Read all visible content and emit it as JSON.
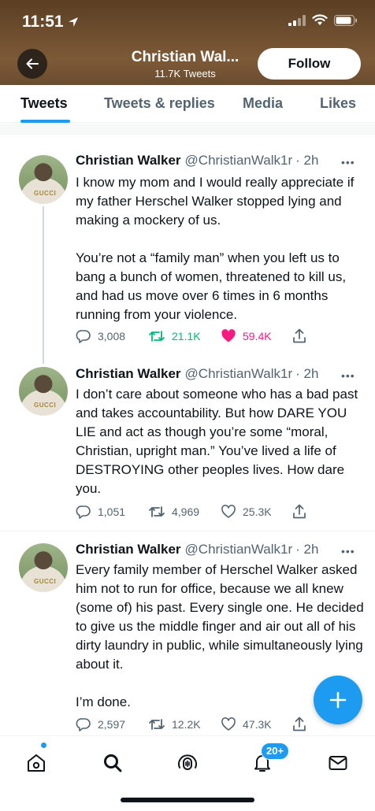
{
  "status_bar": {
    "time": "11:51",
    "icons": [
      "location-arrow-icon",
      "signal-icon",
      "wifi-icon",
      "battery-icon"
    ]
  },
  "header": {
    "name": "Christian Wal...",
    "tweet_count": "11.7K Tweets",
    "follow_label": "Follow"
  },
  "tabs": [
    {
      "label": "Tweets",
      "active": true
    },
    {
      "label": "Tweets & replies",
      "active": false
    },
    {
      "label": "Media",
      "active": false
    },
    {
      "label": "Likes",
      "active": false
    }
  ],
  "tweets": [
    {
      "name": "Christian Walker",
      "handle": "@ChristianWalk1r",
      "time": "· 2h",
      "avatar_text": "GUCCI",
      "paragraphs": [
        "I know my mom and I would really appreciate if my father Herschel Walker stopped lying and making a mockery of us.",
        "You’re not a “family man” when you left us to bang a bunch of women, threatened to kill us, and had us move over 6 times in 6 months running from your violence."
      ],
      "replies": "3,008",
      "retweets": "21.1K",
      "likes": "59.4K",
      "liked": true,
      "retweeted": true
    },
    {
      "name": "Christian Walker",
      "handle": "@ChristianWalk1r",
      "time": "· 2h",
      "avatar_text": "GUCCI",
      "paragraphs": [
        "I don’t care about someone who has a bad past and takes accountability. But how DARE YOU LIE and act as though you’re some “moral, Christian, upright man.” You’ve lived a life of DESTROYING other peoples lives.  How dare you."
      ],
      "replies": "1,051",
      "retweets": "4,969",
      "likes": "25.3K",
      "liked": false,
      "retweeted": false
    },
    {
      "name": "Christian Walker",
      "handle": "@ChristianWalk1r",
      "time": "· 2h",
      "avatar_text": "GUCCI",
      "paragraphs": [
        "Every family member of Herschel Walker asked him not to run for office, because we all knew (some of) his past. Every single one. He decided to give us the middle finger and air out all of his dirty laundry in public, while simultaneously lying about it.",
        "I’m done."
      ],
      "replies": "2,597",
      "retweets": "12.2K",
      "likes": "47.3K",
      "liked": false,
      "retweeted": false
    }
  ],
  "more_label": "•••",
  "bottom_nav": {
    "items": [
      "home-icon",
      "search-icon",
      "spaces-icon",
      "notifications-icon",
      "messages-icon"
    ],
    "notifications_badge": "20+"
  },
  "colors": {
    "accent": "#1d9bf0",
    "retweet": "#00ba7c",
    "like": "#f91880",
    "secondary_text": "#536471"
  }
}
